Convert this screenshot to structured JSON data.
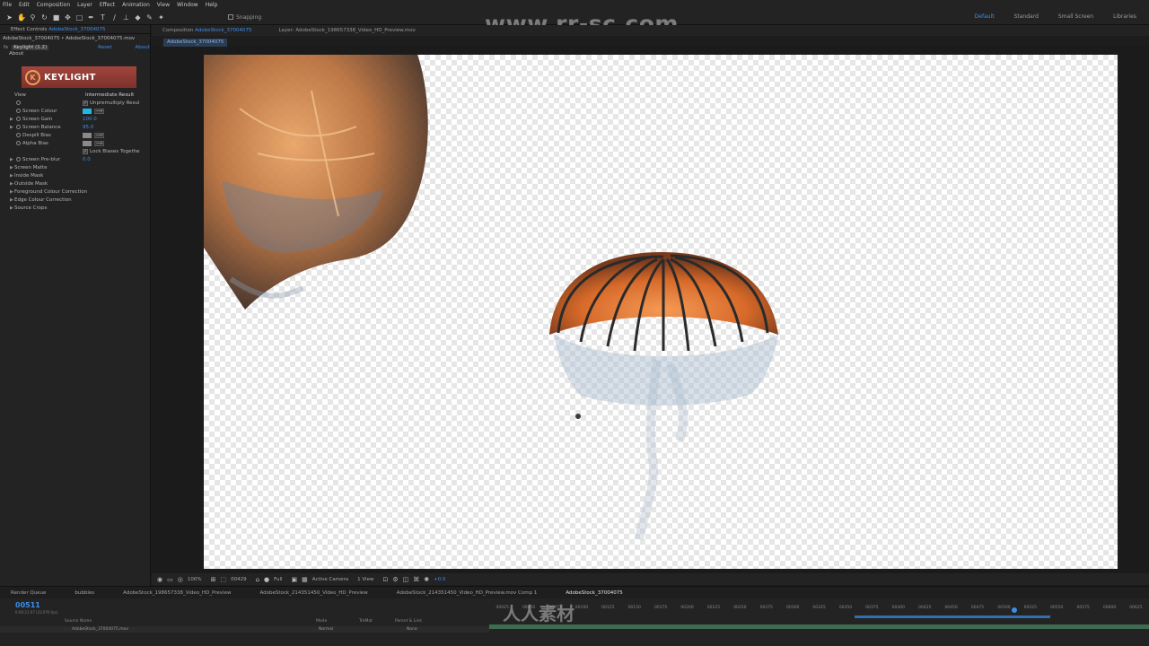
{
  "menu": [
    "File",
    "Edit",
    "Composition",
    "Layer",
    "Effect",
    "Animation",
    "View",
    "Window",
    "Help"
  ],
  "toolbar": {
    "snapping_label": "Snapping"
  },
  "watermarks": {
    "top": "www.rr-sc.com",
    "bottom": "人人素材"
  },
  "workspaces": [
    "Default",
    "Standard",
    "Small Screen",
    "Libraries"
  ],
  "effect_controls": {
    "tab_prefix": "Effect Controls",
    "tab_layer": "AdobeStock_37004075",
    "subtitle": "AdobeStock_37004075 • AdobeStock_37004075.mov",
    "effect_name": "Keylight (1.2)",
    "reset": "Reset",
    "about": "About",
    "about_row": "About",
    "logo_text": "KEYLIGHT",
    "view_label": "View",
    "view_value": "Intermediate Result",
    "unpremultiply": "Unpremultiply Resul",
    "screen_colour": "Screen Colour",
    "screen_colour_hex": "#1fb6e8",
    "screen_gain": "Screen Gain",
    "screen_gain_value": "100.0",
    "screen_balance": "Screen Balance",
    "screen_balance_value": "95.0",
    "despill_bias": "Despill Bias",
    "alpha_bias": "Alpha Bias",
    "lock_biases": "Lock Biases Togethe",
    "screen_preblur": "Screen Pre-blur",
    "screen_preblur_value": "0.0",
    "groups": [
      "Screen Matte",
      "Inside Mask",
      "Outside Mask",
      "Foreground Colour Correction",
      "Edge Colour Correction",
      "Source Crops"
    ]
  },
  "viewer": {
    "comp_tab_prefix": "Composition",
    "comp_tab_name": "AdobeStock_37004075",
    "layer_tab": "Layer: AdobeStock_198657338_Video_HD_Preview.mov",
    "flow_chip": "AdobeStock_37004075",
    "zoom": "100%",
    "frame": "00429",
    "resolution": "Full",
    "camera": "Active Camera",
    "views": "1 View",
    "exposure": "+0.0"
  },
  "timeline": {
    "tabs": [
      "Render Queue",
      "bubbles",
      "AdobeStock_198657338_Video_HD_Preview",
      "AdobeStock_214351450_Video_HD_Preview",
      "AdobeStock_214351450_Video_HD_Preview.mov Comp 1",
      "AdobeStock_37004075"
    ],
    "timecode": "00511",
    "timecode_sub": "0:00:21:07 (23.976 fps)",
    "ruler": [
      "00025",
      "00050",
      "00075",
      "00100",
      "00125",
      "00150",
      "00175",
      "00200",
      "00225",
      "00250",
      "00275",
      "00300",
      "00325",
      "00350",
      "00375",
      "00400",
      "00425",
      "00450",
      "00475",
      "00500",
      "00525",
      "00550",
      "00575",
      "00600",
      "00625"
    ],
    "col_source": "Source Name",
    "col_mode": "Mode",
    "col_trkmat": "TrkMat",
    "col_parent": "Parent & Link",
    "layer_name": "AdobeStock_37004075.mov",
    "layer_mode": "Normal",
    "layer_parent": "None"
  }
}
